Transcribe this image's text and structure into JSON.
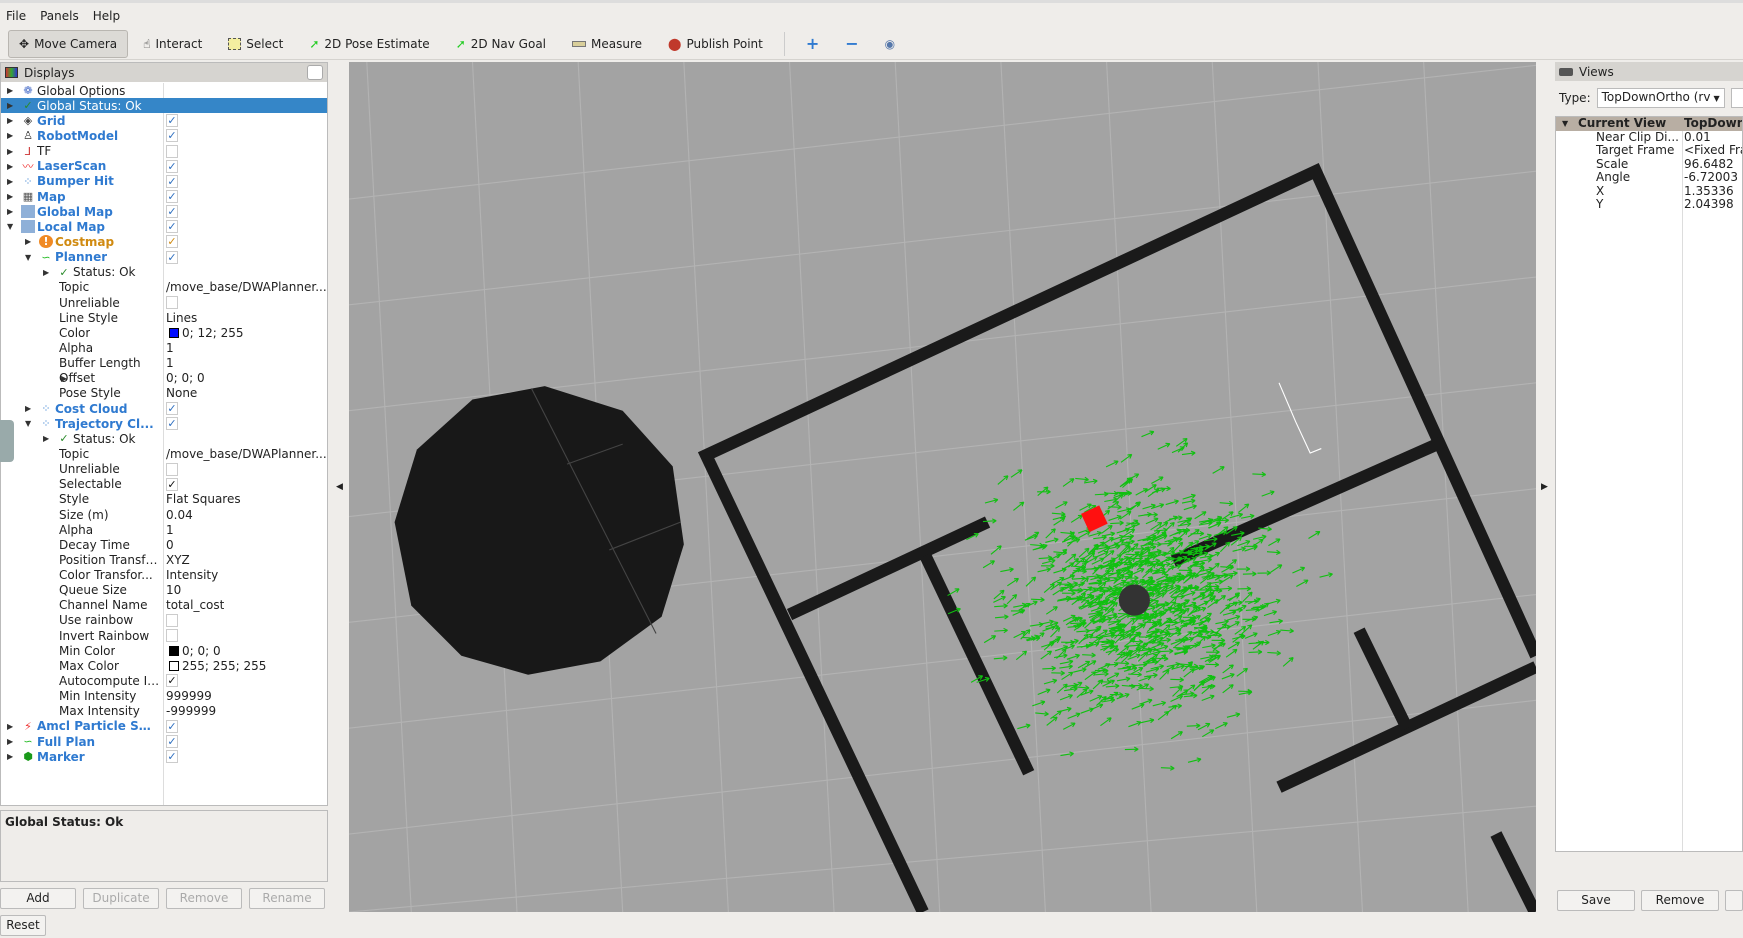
{
  "menu": [
    "File",
    "Panels",
    "Help"
  ],
  "toolbar": {
    "tools": [
      "Move Camera",
      "Interact",
      "Select",
      "2D Pose Estimate",
      "2D Nav Goal",
      "Measure",
      "Publish Point"
    ]
  },
  "displays": {
    "title": "Displays",
    "rows": [
      {
        "label": "Global Options",
        "indent": 0,
        "arrow": "right",
        "icon": "gear-icon",
        "style": "n"
      },
      {
        "label": "Global Status: Ok",
        "indent": 0,
        "arrow": "right",
        "icon": "check-icon",
        "style": "sel"
      },
      {
        "label": "Grid",
        "indent": 0,
        "arrow": "right",
        "icon": "grid-icon",
        "style": "b",
        "check": "✓"
      },
      {
        "label": "RobotModel",
        "indent": 0,
        "arrow": "right",
        "icon": "robot-icon",
        "style": "b",
        "check": "✓"
      },
      {
        "label": "TF",
        "indent": 0,
        "arrow": "right",
        "icon": "axes-icon",
        "style": "n",
        "check": ""
      },
      {
        "label": "LaserScan",
        "indent": 0,
        "arrow": "right",
        "icon": "laser-icon",
        "style": "b",
        "check": "✓"
      },
      {
        "label": "Bumper Hit",
        "indent": 0,
        "arrow": "right",
        "icon": "pointcloud-icon",
        "style": "b",
        "check": "✓"
      },
      {
        "label": "Map",
        "indent": 0,
        "arrow": "right",
        "icon": "map-icon",
        "style": "b",
        "check": "✓"
      },
      {
        "label": "Global Map",
        "indent": 0,
        "arrow": "right",
        "icon": "folder-icon",
        "style": "b",
        "check": "✓"
      },
      {
        "label": "Local Map",
        "indent": 0,
        "arrow": "down",
        "icon": "folder-icon",
        "style": "b",
        "check": "✓"
      },
      {
        "label": "Costmap",
        "indent": 1,
        "arrow": "right",
        "icon": "warning-icon",
        "style": "o",
        "check": "✓"
      },
      {
        "label": "Planner",
        "indent": 1,
        "arrow": "down",
        "icon": "path-icon",
        "style": "b",
        "check": "✓"
      },
      {
        "label": "Status: Ok",
        "indent": 2,
        "arrow": "right",
        "icon": "check-icon",
        "style": "n"
      },
      {
        "label": "Topic",
        "indent": 3,
        "value": "/move_base/DWAPlanner..."
      },
      {
        "label": "Unreliable",
        "indent": 3,
        "check": ""
      },
      {
        "label": "Line Style",
        "indent": 3,
        "value": "Lines"
      },
      {
        "label": "Color",
        "indent": 3,
        "value": "0; 12; 255",
        "swatch": "#000cff"
      },
      {
        "label": "Alpha",
        "indent": 3,
        "value": "1"
      },
      {
        "label": "Buffer Length",
        "indent": 3,
        "value": "1"
      },
      {
        "label": "Offset",
        "indent": 3,
        "arrow": "right",
        "value": "0; 0; 0"
      },
      {
        "label": "Pose Style",
        "indent": 3,
        "value": "None"
      },
      {
        "label": "Cost Cloud",
        "indent": 1,
        "arrow": "right",
        "icon": "pointcloud-icon",
        "style": "b",
        "check": "✓"
      },
      {
        "label": "Trajectory Cl...",
        "indent": 1,
        "arrow": "down",
        "icon": "pointcloud-icon",
        "style": "b",
        "check": "✓"
      },
      {
        "label": "Status: Ok",
        "indent": 2,
        "arrow": "right",
        "icon": "check-icon",
        "style": "n"
      },
      {
        "label": "Topic",
        "indent": 3,
        "value": "/move_base/DWAPlanner..."
      },
      {
        "label": "Unreliable",
        "indent": 3,
        "check": ""
      },
      {
        "label": "Selectable",
        "indent": 3,
        "check": "✓"
      },
      {
        "label": "Style",
        "indent": 3,
        "value": "Flat Squares"
      },
      {
        "label": "Size (m)",
        "indent": 3,
        "value": "0.04"
      },
      {
        "label": "Alpha",
        "indent": 3,
        "value": "1"
      },
      {
        "label": "Decay Time",
        "indent": 3,
        "value": "0"
      },
      {
        "label": "Position Transfo...",
        "indent": 3,
        "value": "XYZ"
      },
      {
        "label": "Color Transfor...",
        "indent": 3,
        "value": "Intensity"
      },
      {
        "label": "Queue Size",
        "indent": 3,
        "value": "10"
      },
      {
        "label": "Channel Name",
        "indent": 3,
        "value": "total_cost"
      },
      {
        "label": "Use rainbow",
        "indent": 3,
        "check": ""
      },
      {
        "label": "Invert Rainbow",
        "indent": 3,
        "check": ""
      },
      {
        "label": "Min Color",
        "indent": 3,
        "value": "0; 0; 0",
        "swatch": "#000000"
      },
      {
        "label": "Max Color",
        "indent": 3,
        "value": "255; 255; 255",
        "swatch": "#ffffff"
      },
      {
        "label": "Autocompute In...",
        "indent": 3,
        "check": "✓"
      },
      {
        "label": "Min Intensity",
        "indent": 3,
        "value": "999999"
      },
      {
        "label": "Max Intensity",
        "indent": 3,
        "value": "-999999"
      },
      {
        "label": "Amcl Particle Sw...",
        "indent": 0,
        "arrow": "right",
        "icon": "particles-icon",
        "style": "b",
        "check": "✓"
      },
      {
        "label": "Full Plan",
        "indent": 0,
        "arrow": "right",
        "icon": "path-icon",
        "style": "b",
        "check": "✓"
      },
      {
        "label": "Marker",
        "indent": 0,
        "arrow": "right",
        "icon": "marker-icon",
        "style": "b",
        "check": "✓"
      }
    ],
    "status_text": "Global Status: Ok",
    "buttons": {
      "add": "Add",
      "duplicate": "Duplicate",
      "remove": "Remove",
      "rename": "Rename"
    },
    "reset": "Reset"
  },
  "views": {
    "title": "Views",
    "type_label": "Type:",
    "type_value": "TopDownOrtho (rv",
    "header": [
      "Current View",
      "TopDown"
    ],
    "props": [
      [
        "Near Clip Di...",
        "0.01"
      ],
      [
        "Target Frame",
        "<Fixed Fra"
      ],
      [
        "Scale",
        "96.6482"
      ],
      [
        "Angle",
        "-6.72003"
      ],
      [
        "X",
        " 1.35336"
      ],
      [
        "Y",
        "2.04398"
      ]
    ],
    "save": "Save",
    "remove": "Remove"
  },
  "colors": {
    "selection": "#3586c8",
    "link": "#2f7ad0",
    "trajectory": "#10c010",
    "goal": "#ff1010"
  }
}
